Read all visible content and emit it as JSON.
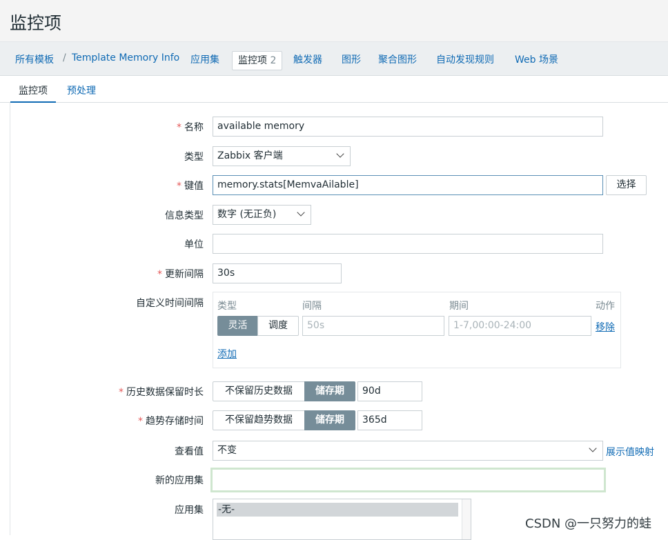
{
  "page": {
    "title": "监控项"
  },
  "nav": {
    "all_templates": "所有模板",
    "separator": "/",
    "template_name": "Template Memory Info",
    "applications": "应用集",
    "items": "监控项",
    "items_count": "2",
    "triggers": "触发器",
    "graphs": "图形",
    "screens": "聚合图形",
    "discovery": "自动发现规则",
    "web": "Web 场景"
  },
  "subtabs": {
    "item": "监控项",
    "preprocessing": "预处理"
  },
  "form": {
    "name_label": "名称",
    "name_value": "available memory",
    "type_label": "类型",
    "type_value": "Zabbix 客户端",
    "key_label": "键值",
    "key_value": "memory.stats[MemvaAilable]",
    "select_button": "选择",
    "info_type_label": "信息类型",
    "info_type_value": "数字 (无正负)",
    "units_label": "单位",
    "units_value": "",
    "interval_label": "更新间隔",
    "interval_value": "30s",
    "custom_label": "自定义时间间隔",
    "custom": {
      "col_type": "类型",
      "col_interval": "间隔",
      "col_period": "期间",
      "col_action": "动作",
      "flexible": "灵活",
      "scheduling": "调度",
      "interval_placeholder": "50s",
      "period_placeholder": "1-7,00:00-24:00",
      "remove": "移除",
      "add": "添加"
    },
    "history_label": "历史数据保留时长",
    "history_off": "不保留历史数据",
    "history_on": "储存期",
    "history_value": "90d",
    "trends_label": "趋势存储时间",
    "trends_off": "不保留趋势数据",
    "trends_on": "储存期",
    "trends_value": "365d",
    "valuemap_label": "查看值",
    "valuemap_value": "不变",
    "valuemap_link": "展示值映射",
    "new_app_label": "新的应用集",
    "new_app_value": "",
    "apps_label": "应用集",
    "apps_options": [
      "-无-"
    ]
  },
  "watermark": "CSDN @一只努力的蛙",
  "colors": {
    "link": "#0f6ab4",
    "required": "#e45959",
    "segment_active": "#768d99"
  }
}
